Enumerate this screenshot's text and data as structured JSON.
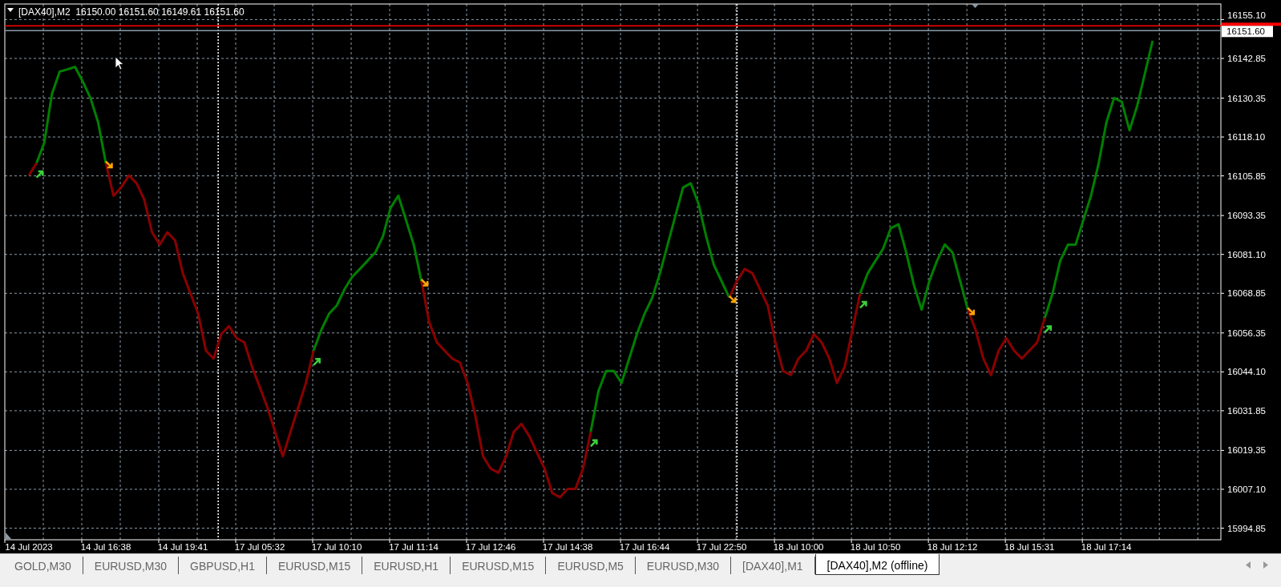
{
  "chart_header": "[DAX40],M2  16150.00 16151.60 16149.61 16151.60",
  "chart_data": {
    "type": "line",
    "grid": true,
    "ylim": [
      15991.2,
      16160.0
    ],
    "categories": [
      "14 Jul 2023",
      null,
      null,
      null,
      null,
      null,
      null,
      null,
      null,
      null,
      "14 Jul 16:38",
      null,
      null,
      null,
      null,
      null,
      null,
      null,
      null,
      null,
      "14 Jul 19:41",
      null,
      null,
      null,
      null,
      null,
      null,
      null,
      null,
      null,
      "17 Jul 05:32",
      null,
      null,
      null,
      null,
      null,
      null,
      null,
      null,
      null,
      "17 Jul 10:10",
      null,
      null,
      null,
      null,
      null,
      null,
      null,
      null,
      null,
      "17 Jul 11:14",
      null,
      null,
      null,
      null,
      null,
      null,
      null,
      null,
      null,
      "17 Jul 12:46",
      null,
      null,
      null,
      null,
      null,
      null,
      null,
      null,
      null,
      "17 Jul 14:38",
      null,
      null,
      null,
      null,
      null,
      null,
      null,
      null,
      null,
      "17 Jul 16:44",
      null,
      null,
      null,
      null,
      null,
      null,
      null,
      null,
      null,
      "17 Jul 22:50",
      null,
      null,
      null,
      null,
      null,
      null,
      null,
      null,
      null,
      "18 Jul 10:00",
      null,
      null,
      null,
      null,
      null,
      null,
      null,
      null,
      null,
      "18 Jul 10:50",
      null,
      null,
      null,
      null,
      null,
      null,
      null,
      null,
      null,
      "18 Jul 12:12",
      null,
      null,
      null,
      null,
      null,
      null,
      null,
      null,
      null,
      "18 Jul 15:31",
      null,
      null,
      null,
      null,
      null,
      null,
      null,
      null,
      null,
      "18 Jul 17:14",
      null,
      null,
      null,
      null,
      null,
      null,
      null,
      null,
      null,
      null,
      null,
      null,
      null,
      null,
      null,
      null,
      null,
      null
    ],
    "yticks": [
      {
        "value": 16155.1,
        "label": "16155.10"
      },
      {
        "value": 16142.85,
        "label": "16142.85"
      },
      {
        "value": 16130.35,
        "label": "16130.35"
      },
      {
        "value": 16118.1,
        "label": "16118.10"
      },
      {
        "value": 16105.85,
        "label": "16105.85"
      },
      {
        "value": 16093.35,
        "label": "16093.35"
      },
      {
        "value": 16081.1,
        "label": "16081.10"
      },
      {
        "value": 16068.85,
        "label": "16068.85"
      },
      {
        "value": 16056.35,
        "label": "16056.35"
      },
      {
        "value": 16044.1,
        "label": "16044.10"
      },
      {
        "value": 16031.85,
        "label": "16031.85"
      },
      {
        "value": 16019.35,
        "label": "16019.35"
      },
      {
        "value": 16007.1,
        "label": "16007.10"
      },
      {
        "value": 15994.85,
        "label": "15994.85"
      }
    ],
    "series": [
      {
        "color": "#008000",
        "values": [
          null,
          16109.9,
          16116.3,
          16131.7,
          16138.7,
          16139.4,
          16140.2,
          16135.6,
          16130.4,
          16122.7,
          16109.9,
          null,
          null,
          null,
          null,
          null,
          null,
          null,
          null,
          null,
          null,
          null,
          null,
          null,
          null,
          null,
          null,
          null,
          null,
          null,
          null,
          null,
          null,
          null,
          null,
          null,
          null,
          16050.8,
          16057.3,
          16062.4,
          16065.0,
          16070.1,
          16074.0,
          16076.5,
          16079.1,
          16081.7,
          16086.8,
          16095.8,
          16099.6,
          16091.9,
          16084.2,
          16072.7,
          null,
          null,
          null,
          null,
          null,
          null,
          null,
          null,
          null,
          null,
          null,
          null,
          null,
          null,
          null,
          null,
          null,
          null,
          null,
          null,
          null,
          16025.2,
          16038.0,
          16044.4,
          16044.4,
          16040.6,
          16048.3,
          16056.0,
          16062.4,
          16067.5,
          16075.2,
          16084.2,
          16093.2,
          16102.2,
          16103.5,
          16097.1,
          16086.8,
          16077.8,
          16072.7,
          16067.5,
          null,
          null,
          null,
          null,
          null,
          null,
          null,
          null,
          null,
          null,
          null,
          null,
          null,
          null,
          null,
          null,
          16068.8,
          16075.2,
          16079.1,
          16082.9,
          16089.4,
          16090.6,
          16081.7,
          16071.4,
          16063.7,
          16072.7,
          16079.1,
          16084.2,
          16081.7,
          16072.7,
          16063.7,
          null,
          null,
          null,
          null,
          null,
          null,
          null,
          null,
          null,
          16061.1,
          16068.8,
          16079.1,
          16084.2,
          16084.2,
          16091.9,
          16099.6,
          16109.9,
          16122.7,
          16130.4,
          16129.2,
          16120.2,
          16127.9,
          16138.1,
          16148.4,
          null,
          null,
          null,
          null,
          null,
          null,
          null,
          null,
          null,
          null,
          null,
          null
        ]
      },
      {
        "color": "#8b0000",
        "values": [
          16106.0,
          16109.9,
          null,
          null,
          null,
          null,
          null,
          null,
          null,
          null,
          16109.9,
          16099.6,
          16102.2,
          16106.0,
          16103.5,
          16098.3,
          16088.1,
          16084.2,
          16088.1,
          16085.5,
          16075.2,
          16068.8,
          16062.4,
          16050.8,
          16048.3,
          16056.0,
          16058.5,
          16054.7,
          16053.4,
          16045.7,
          16039.3,
          16032.9,
          16025.2,
          16017.5,
          16025.2,
          16032.9,
          16040.6,
          16050.8,
          null,
          null,
          null,
          null,
          null,
          null,
          null,
          null,
          null,
          null,
          null,
          null,
          null,
          16072.7,
          16059.8,
          16053.4,
          16050.8,
          16048.3,
          16047.0,
          16040.6,
          16030.3,
          16017.5,
          16013.6,
          16012.3,
          16017.5,
          16025.2,
          16027.7,
          16023.9,
          16018.7,
          16013.6,
          16005.9,
          16004.6,
          16007.2,
          16007.2,
          16013.6,
          16025.2,
          null,
          null,
          null,
          null,
          null,
          null,
          null,
          null,
          null,
          null,
          null,
          null,
          null,
          null,
          null,
          null,
          null,
          16067.5,
          16072.7,
          16076.5,
          16075.2,
          16070.1,
          16065.0,
          16053.4,
          16044.4,
          16043.1,
          16048.3,
          16050.8,
          16056.0,
          16053.4,
          16048.3,
          16040.6,
          16045.7,
          16057.3,
          16068.8,
          null,
          null,
          null,
          null,
          null,
          null,
          null,
          null,
          null,
          null,
          null,
          null,
          null,
          16063.7,
          16057.3,
          16048.3,
          16043.1,
          16050.8,
          16054.7,
          16050.8,
          16048.3,
          16050.8,
          16053.4,
          16061.1,
          null,
          null,
          null,
          null,
          null,
          null,
          null,
          null,
          null,
          null,
          null,
          null,
          null,
          null,
          null,
          null,
          null,
          null,
          null,
          null,
          null,
          null,
          null,
          null,
          null,
          null
        ]
      }
    ],
    "title": null
  },
  "price_tag": "16151.60",
  "tabs": [
    {
      "label": "GOLD,M30",
      "selected": false
    },
    {
      "label": "EURUSD,M30",
      "selected": false
    },
    {
      "label": "GBPUSD,H1",
      "selected": false
    },
    {
      "label": "EURUSD,M15",
      "selected": false
    },
    {
      "label": "EURUSD,H1",
      "selected": false
    },
    {
      "label": "EURUSD,M15",
      "selected": false
    },
    {
      "label": "EURUSD,M5",
      "selected": false
    },
    {
      "label": "EURUSD,M30",
      "selected": false
    },
    {
      "label": "[DAX40],M1",
      "selected": false
    },
    {
      "label": "[DAX40],M2 (offline)",
      "selected": true
    }
  ]
}
